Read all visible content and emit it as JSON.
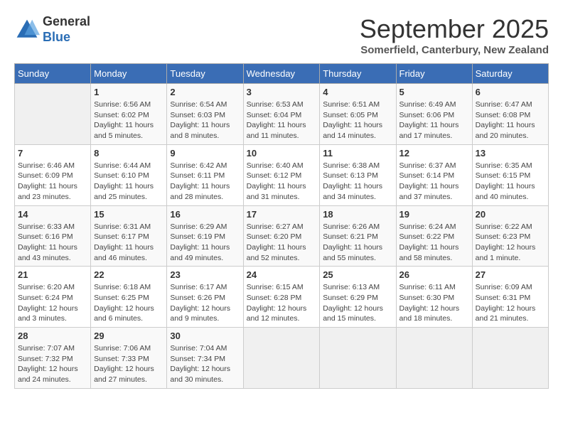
{
  "header": {
    "logo_line1": "General",
    "logo_line2": "Blue",
    "month": "September 2025",
    "location": "Somerfield, Canterbury, New Zealand"
  },
  "days_of_week": [
    "Sunday",
    "Monday",
    "Tuesday",
    "Wednesday",
    "Thursday",
    "Friday",
    "Saturday"
  ],
  "weeks": [
    [
      {
        "num": "",
        "sunrise": "",
        "sunset": "",
        "daylight": ""
      },
      {
        "num": "1",
        "sunrise": "Sunrise: 6:56 AM",
        "sunset": "Sunset: 6:02 PM",
        "daylight": "Daylight: 11 hours and 5 minutes."
      },
      {
        "num": "2",
        "sunrise": "Sunrise: 6:54 AM",
        "sunset": "Sunset: 6:03 PM",
        "daylight": "Daylight: 11 hours and 8 minutes."
      },
      {
        "num": "3",
        "sunrise": "Sunrise: 6:53 AM",
        "sunset": "Sunset: 6:04 PM",
        "daylight": "Daylight: 11 hours and 11 minutes."
      },
      {
        "num": "4",
        "sunrise": "Sunrise: 6:51 AM",
        "sunset": "Sunset: 6:05 PM",
        "daylight": "Daylight: 11 hours and 14 minutes."
      },
      {
        "num": "5",
        "sunrise": "Sunrise: 6:49 AM",
        "sunset": "Sunset: 6:06 PM",
        "daylight": "Daylight: 11 hours and 17 minutes."
      },
      {
        "num": "6",
        "sunrise": "Sunrise: 6:47 AM",
        "sunset": "Sunset: 6:08 PM",
        "daylight": "Daylight: 11 hours and 20 minutes."
      }
    ],
    [
      {
        "num": "7",
        "sunrise": "Sunrise: 6:46 AM",
        "sunset": "Sunset: 6:09 PM",
        "daylight": "Daylight: 11 hours and 23 minutes."
      },
      {
        "num": "8",
        "sunrise": "Sunrise: 6:44 AM",
        "sunset": "Sunset: 6:10 PM",
        "daylight": "Daylight: 11 hours and 25 minutes."
      },
      {
        "num": "9",
        "sunrise": "Sunrise: 6:42 AM",
        "sunset": "Sunset: 6:11 PM",
        "daylight": "Daylight: 11 hours and 28 minutes."
      },
      {
        "num": "10",
        "sunrise": "Sunrise: 6:40 AM",
        "sunset": "Sunset: 6:12 PM",
        "daylight": "Daylight: 11 hours and 31 minutes."
      },
      {
        "num": "11",
        "sunrise": "Sunrise: 6:38 AM",
        "sunset": "Sunset: 6:13 PM",
        "daylight": "Daylight: 11 hours and 34 minutes."
      },
      {
        "num": "12",
        "sunrise": "Sunrise: 6:37 AM",
        "sunset": "Sunset: 6:14 PM",
        "daylight": "Daylight: 11 hours and 37 minutes."
      },
      {
        "num": "13",
        "sunrise": "Sunrise: 6:35 AM",
        "sunset": "Sunset: 6:15 PM",
        "daylight": "Daylight: 11 hours and 40 minutes."
      }
    ],
    [
      {
        "num": "14",
        "sunrise": "Sunrise: 6:33 AM",
        "sunset": "Sunset: 6:16 PM",
        "daylight": "Daylight: 11 hours and 43 minutes."
      },
      {
        "num": "15",
        "sunrise": "Sunrise: 6:31 AM",
        "sunset": "Sunset: 6:17 PM",
        "daylight": "Daylight: 11 hours and 46 minutes."
      },
      {
        "num": "16",
        "sunrise": "Sunrise: 6:29 AM",
        "sunset": "Sunset: 6:19 PM",
        "daylight": "Daylight: 11 hours and 49 minutes."
      },
      {
        "num": "17",
        "sunrise": "Sunrise: 6:27 AM",
        "sunset": "Sunset: 6:20 PM",
        "daylight": "Daylight: 11 hours and 52 minutes."
      },
      {
        "num": "18",
        "sunrise": "Sunrise: 6:26 AM",
        "sunset": "Sunset: 6:21 PM",
        "daylight": "Daylight: 11 hours and 55 minutes."
      },
      {
        "num": "19",
        "sunrise": "Sunrise: 6:24 AM",
        "sunset": "Sunset: 6:22 PM",
        "daylight": "Daylight: 11 hours and 58 minutes."
      },
      {
        "num": "20",
        "sunrise": "Sunrise: 6:22 AM",
        "sunset": "Sunset: 6:23 PM",
        "daylight": "Daylight: 12 hours and 1 minute."
      }
    ],
    [
      {
        "num": "21",
        "sunrise": "Sunrise: 6:20 AM",
        "sunset": "Sunset: 6:24 PM",
        "daylight": "Daylight: 12 hours and 3 minutes."
      },
      {
        "num": "22",
        "sunrise": "Sunrise: 6:18 AM",
        "sunset": "Sunset: 6:25 PM",
        "daylight": "Daylight: 12 hours and 6 minutes."
      },
      {
        "num": "23",
        "sunrise": "Sunrise: 6:17 AM",
        "sunset": "Sunset: 6:26 PM",
        "daylight": "Daylight: 12 hours and 9 minutes."
      },
      {
        "num": "24",
        "sunrise": "Sunrise: 6:15 AM",
        "sunset": "Sunset: 6:28 PM",
        "daylight": "Daylight: 12 hours and 12 minutes."
      },
      {
        "num": "25",
        "sunrise": "Sunrise: 6:13 AM",
        "sunset": "Sunset: 6:29 PM",
        "daylight": "Daylight: 12 hours and 15 minutes."
      },
      {
        "num": "26",
        "sunrise": "Sunrise: 6:11 AM",
        "sunset": "Sunset: 6:30 PM",
        "daylight": "Daylight: 12 hours and 18 minutes."
      },
      {
        "num": "27",
        "sunrise": "Sunrise: 6:09 AM",
        "sunset": "Sunset: 6:31 PM",
        "daylight": "Daylight: 12 hours and 21 minutes."
      }
    ],
    [
      {
        "num": "28",
        "sunrise": "Sunrise: 7:07 AM",
        "sunset": "Sunset: 7:32 PM",
        "daylight": "Daylight: 12 hours and 24 minutes."
      },
      {
        "num": "29",
        "sunrise": "Sunrise: 7:06 AM",
        "sunset": "Sunset: 7:33 PM",
        "daylight": "Daylight: 12 hours and 27 minutes."
      },
      {
        "num": "30",
        "sunrise": "Sunrise: 7:04 AM",
        "sunset": "Sunset: 7:34 PM",
        "daylight": "Daylight: 12 hours and 30 minutes."
      },
      {
        "num": "",
        "sunrise": "",
        "sunset": "",
        "daylight": ""
      },
      {
        "num": "",
        "sunrise": "",
        "sunset": "",
        "daylight": ""
      },
      {
        "num": "",
        "sunrise": "",
        "sunset": "",
        "daylight": ""
      },
      {
        "num": "",
        "sunrise": "",
        "sunset": "",
        "daylight": ""
      }
    ]
  ]
}
